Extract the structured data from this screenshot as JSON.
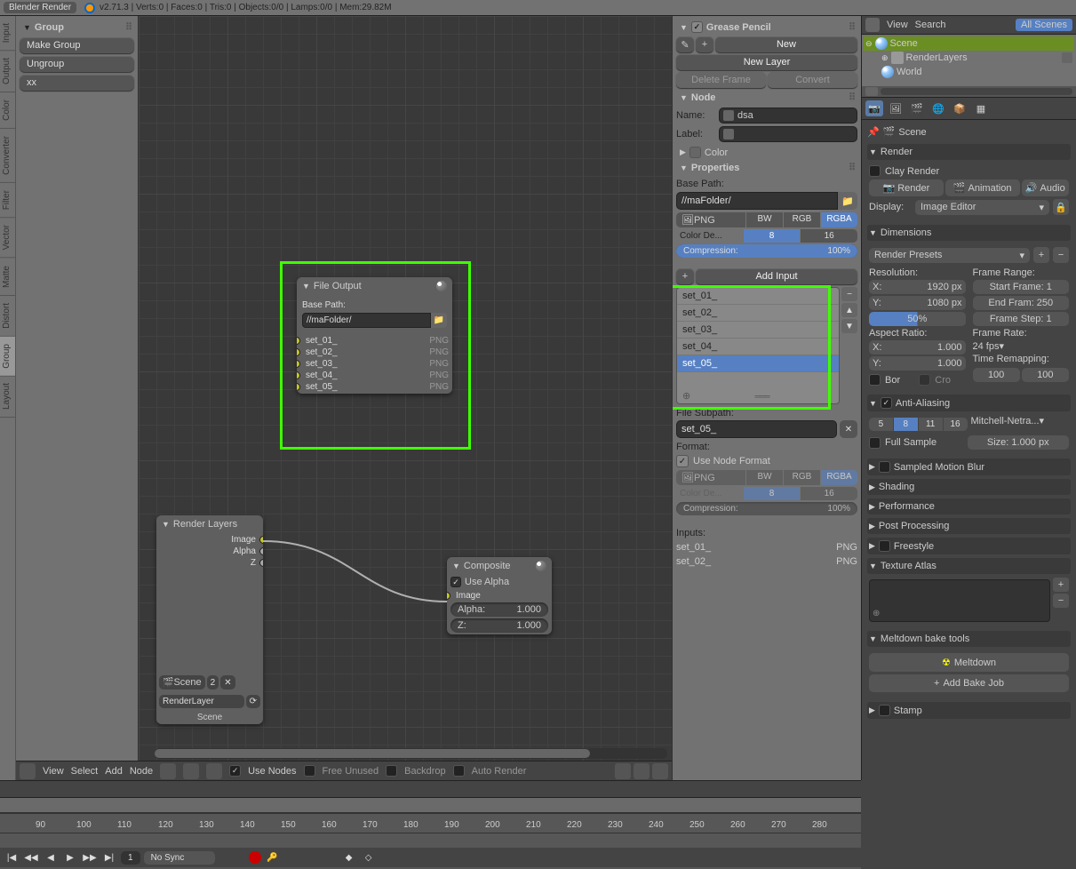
{
  "topbar": {
    "render_engine": "Blender Render",
    "info": "v2.71.3 | Verts:0 | Faces:0 | Tris:0 | Objects:0/0 | Lamps:0/0 | Mem:29.82M"
  },
  "side_tabs": [
    "Input",
    "Output",
    "Color",
    "Converter",
    "Filter",
    "Vector",
    "Matte",
    "Distort",
    "Group",
    "Layout"
  ],
  "left_panel": {
    "title": "Group",
    "buttons": [
      "Make Group",
      "Ungroup",
      "xx"
    ]
  },
  "nodes": {
    "file_output": {
      "title": "File Output",
      "base_path_label": "Base Path:",
      "base_path": "//maFolder/",
      "rows": [
        {
          "name": "set_01_",
          "fmt": "PNG"
        },
        {
          "name": "set_02_",
          "fmt": "PNG"
        },
        {
          "name": "set_03_",
          "fmt": "PNG"
        },
        {
          "name": "set_04_",
          "fmt": "PNG"
        },
        {
          "name": "set_05_",
          "fmt": "PNG"
        }
      ]
    },
    "render_layers": {
      "title": "Render Layers",
      "outputs": [
        "Image",
        "Alpha",
        "Z"
      ],
      "scene_btn": "Scene",
      "scene_num": "2",
      "layer_dropdown": "RenderLayer",
      "caption": "Scene"
    },
    "composite": {
      "title": "Composite",
      "use_alpha": "Use Alpha",
      "image": "Image",
      "alpha_label": "Alpha:",
      "alpha_val": "1.000",
      "z_label": "Z:",
      "z_val": "1.000"
    }
  },
  "n_panel": {
    "grease": {
      "title": "Grease Pencil",
      "new": "New",
      "new_layer": "New Layer",
      "delete_frame": "Delete Frame",
      "convert": "Convert"
    },
    "node": {
      "title": "Node",
      "name_label": "Name:",
      "name_value": "dsa",
      "label_label": "Label:",
      "color_section": "Color"
    },
    "properties": {
      "title": "Properties",
      "base_path_label": "Base Path:",
      "base_path": "//maFolder/",
      "format": "PNG",
      "bw": "BW",
      "rgb": "RGB",
      "rgba": "RGBA",
      "color_depth_label": "Color De...",
      "cd_8": "8",
      "cd_16": "16",
      "compression_label": "Compression:",
      "compression_val": "100%",
      "add_input": "Add Input",
      "inputs": [
        "set_01_",
        "set_02_",
        "set_03_",
        "set_04_",
        "set_05_"
      ],
      "selected_index": 4,
      "file_subpath_label": "File Subpath:",
      "file_subpath": "set_05_",
      "format_label": "Format:",
      "use_node_format": "Use Node Format",
      "format2": "PNG",
      "cd2_8": "8",
      "cd2_16": "16",
      "compression2": "100%",
      "inputs_label": "Inputs:",
      "bottom_inputs": [
        {
          "n": "set_01_",
          "f": "PNG"
        },
        {
          "n": "set_02_",
          "f": "PNG"
        }
      ]
    }
  },
  "outliner": {
    "view": "View",
    "search": "Search",
    "all_scenes": "All Scenes",
    "rows": [
      {
        "name": "Scene",
        "sel": true,
        "indent": 0
      },
      {
        "name": "RenderLayers",
        "sel": false,
        "indent": 1
      },
      {
        "name": "World",
        "sel": false,
        "indent": 1
      }
    ]
  },
  "props": {
    "scene_crumb": "Scene",
    "render_section": "Render",
    "clay_render": "Clay Render",
    "render_btn": "Render",
    "anim_btn": "Animation",
    "audio_btn": "Audio",
    "display_label": "Display:",
    "display_value": "Image Editor",
    "dimensions": "Dimensions",
    "render_presets": "Render Presets",
    "resolution": "Resolution:",
    "frame_range": "Frame Range:",
    "res_x_label": "X:",
    "res_x": "1920 px",
    "start_frame": "Start Frame: 1",
    "res_y_label": "Y:",
    "res_y": "1080 px",
    "end_frame": "End Fram: 250",
    "res_pct": "50%",
    "frame_step": "Frame Step: 1",
    "aspect": "Aspect Ratio:",
    "frame_rate": "Frame Rate:",
    "ax_label": "X:",
    "ax": "1.000",
    "fps": "24 fps",
    "ay_label": "Y:",
    "ay": "1.000",
    "time_remap": "Time Remapping:",
    "bor": "Bor",
    "cro": "Cro",
    "tr_100a": "100",
    "tr_100b": "100",
    "aa": "Anti-Aliasing",
    "aa_5": "5",
    "aa_8": "8",
    "aa_11": "11",
    "aa_16": "16",
    "aa_filter": "Mitchell-Netra...",
    "full_sample": "Full Sample",
    "aa_size": "Size: 1.000 px",
    "motion_blur": "Sampled Motion Blur",
    "shading": "Shading",
    "performance": "Performance",
    "post_processing": "Post Processing",
    "freestyle": "Freestyle",
    "texture_atlas": "Texture Atlas",
    "meltdown_tools": "Meltdown bake tools",
    "meltdown_btn": "Meltdown",
    "add_bake": "Add Bake Job",
    "stamp": "Stamp"
  },
  "node_header": {
    "view": "View",
    "select": "Select",
    "add": "Add",
    "node": "Node",
    "use_nodes": "Use Nodes",
    "free_unused": "Free Unused",
    "backdrop": "Backdrop",
    "auto_render": "Auto Render"
  },
  "timeline": {
    "ticks": [
      90,
      100,
      110,
      120,
      130,
      140,
      150,
      160,
      170,
      180,
      190,
      200,
      210,
      220,
      230,
      240,
      250,
      260,
      270,
      280
    ],
    "no_sync": "No Sync",
    "frame": "1"
  }
}
